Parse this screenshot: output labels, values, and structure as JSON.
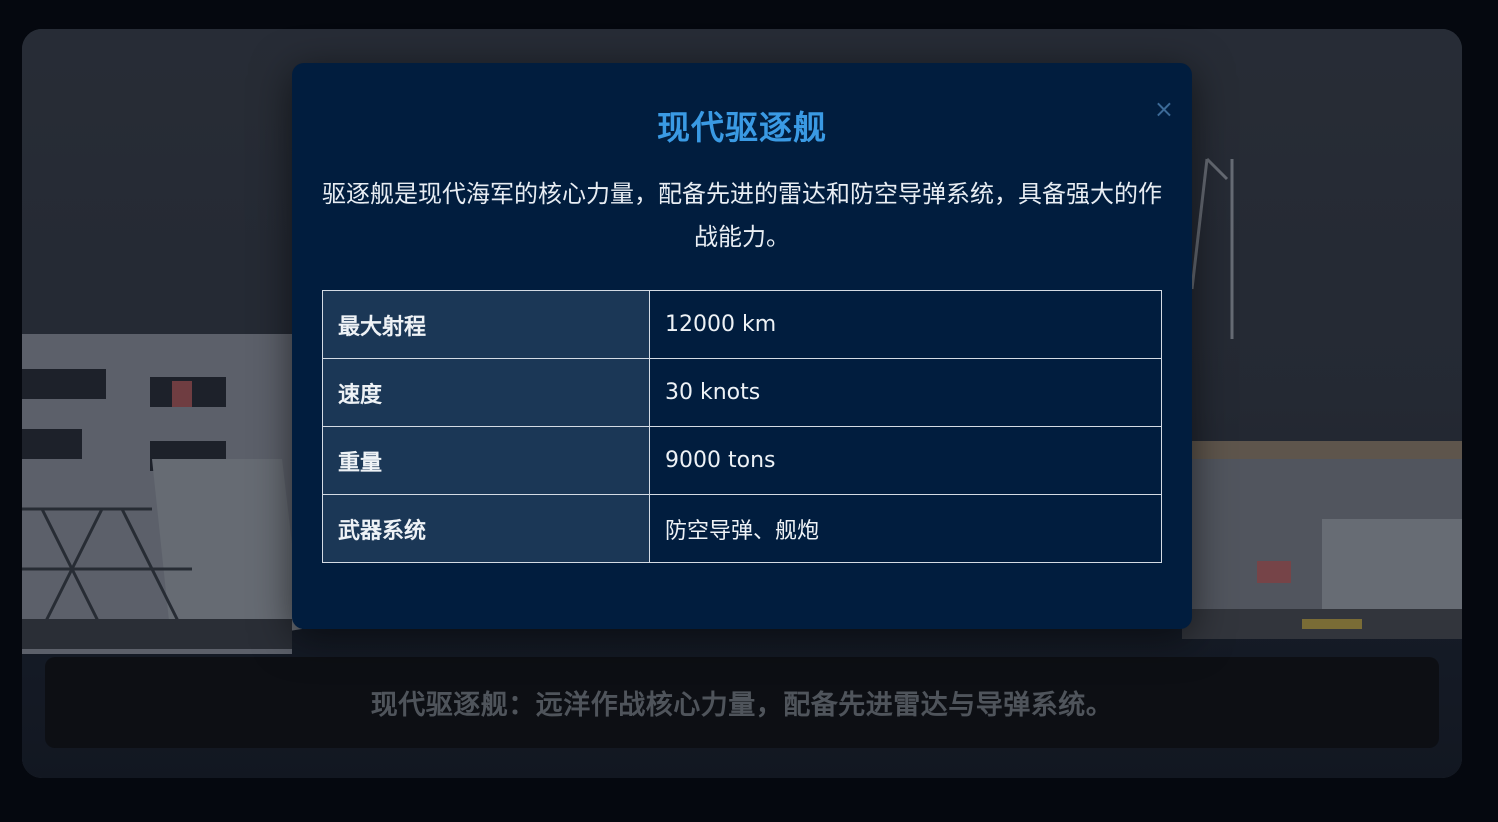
{
  "background": {
    "caption": "现代驱逐舰：远洋作战核心力量，配备先进雷达与导弹系统。"
  },
  "modal": {
    "title": "现代驱逐舰",
    "close_symbol": "×",
    "description": "驱逐舰是现代海军的核心力量，配备先进的雷达和防空导弹系统，具备强大的作战能力。",
    "specs": [
      {
        "label": "最大射程",
        "value": "12000 km"
      },
      {
        "label": "速度",
        "value": "30 knots"
      },
      {
        "label": "重量",
        "value": "9000 tons"
      },
      {
        "label": "武器系统",
        "value": "防空导弹、舰炮"
      }
    ]
  },
  "colors": {
    "modal_bg": "#011d3e",
    "title": "#3a9ae4",
    "table_key_bg": "#1b3756",
    "page_bg": "#05080f"
  }
}
